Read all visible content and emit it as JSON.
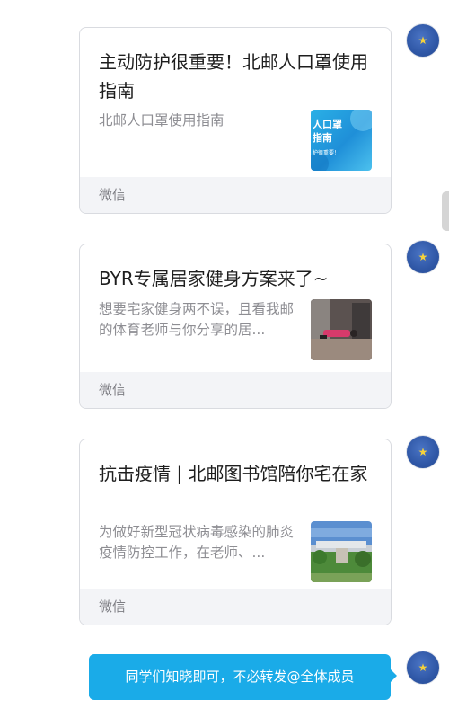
{
  "colors": {
    "bubble": "#1aabe8",
    "avatar": "#2f57a6",
    "card_footer": "#f3f4f7",
    "desc_text": "#8e8e93"
  },
  "messages": [
    {
      "title": "主动防护很重要！北邮人口罩使用指南",
      "description": "北邮人口罩使用指南",
      "source": "微信",
      "thumbnail": {
        "icon": "mask-guide-thumbnail",
        "text_lines": [
          "人口罩",
          "指南",
          "护很重要！"
        ]
      }
    },
    {
      "title": "BYR专属居家健身方案来了~",
      "description": "想要宅家健身两不误，且看我邮的体育老师与你分享的居...",
      "source": "微信",
      "thumbnail": {
        "icon": "home-workout-photo"
      }
    },
    {
      "title": "抗击疫情 | 北邮图书馆陪你宅在家",
      "description": "为做好新型冠状病毒感染的肺炎疫情防控工作，在老师、...",
      "source": "微信",
      "thumbnail": {
        "icon": "library-campus-photo"
      }
    }
  ],
  "text_message": {
    "text": "同学们知晓即可，不必转发@全体成员"
  },
  "avatar": {
    "icon": "star-avatar-icon"
  }
}
